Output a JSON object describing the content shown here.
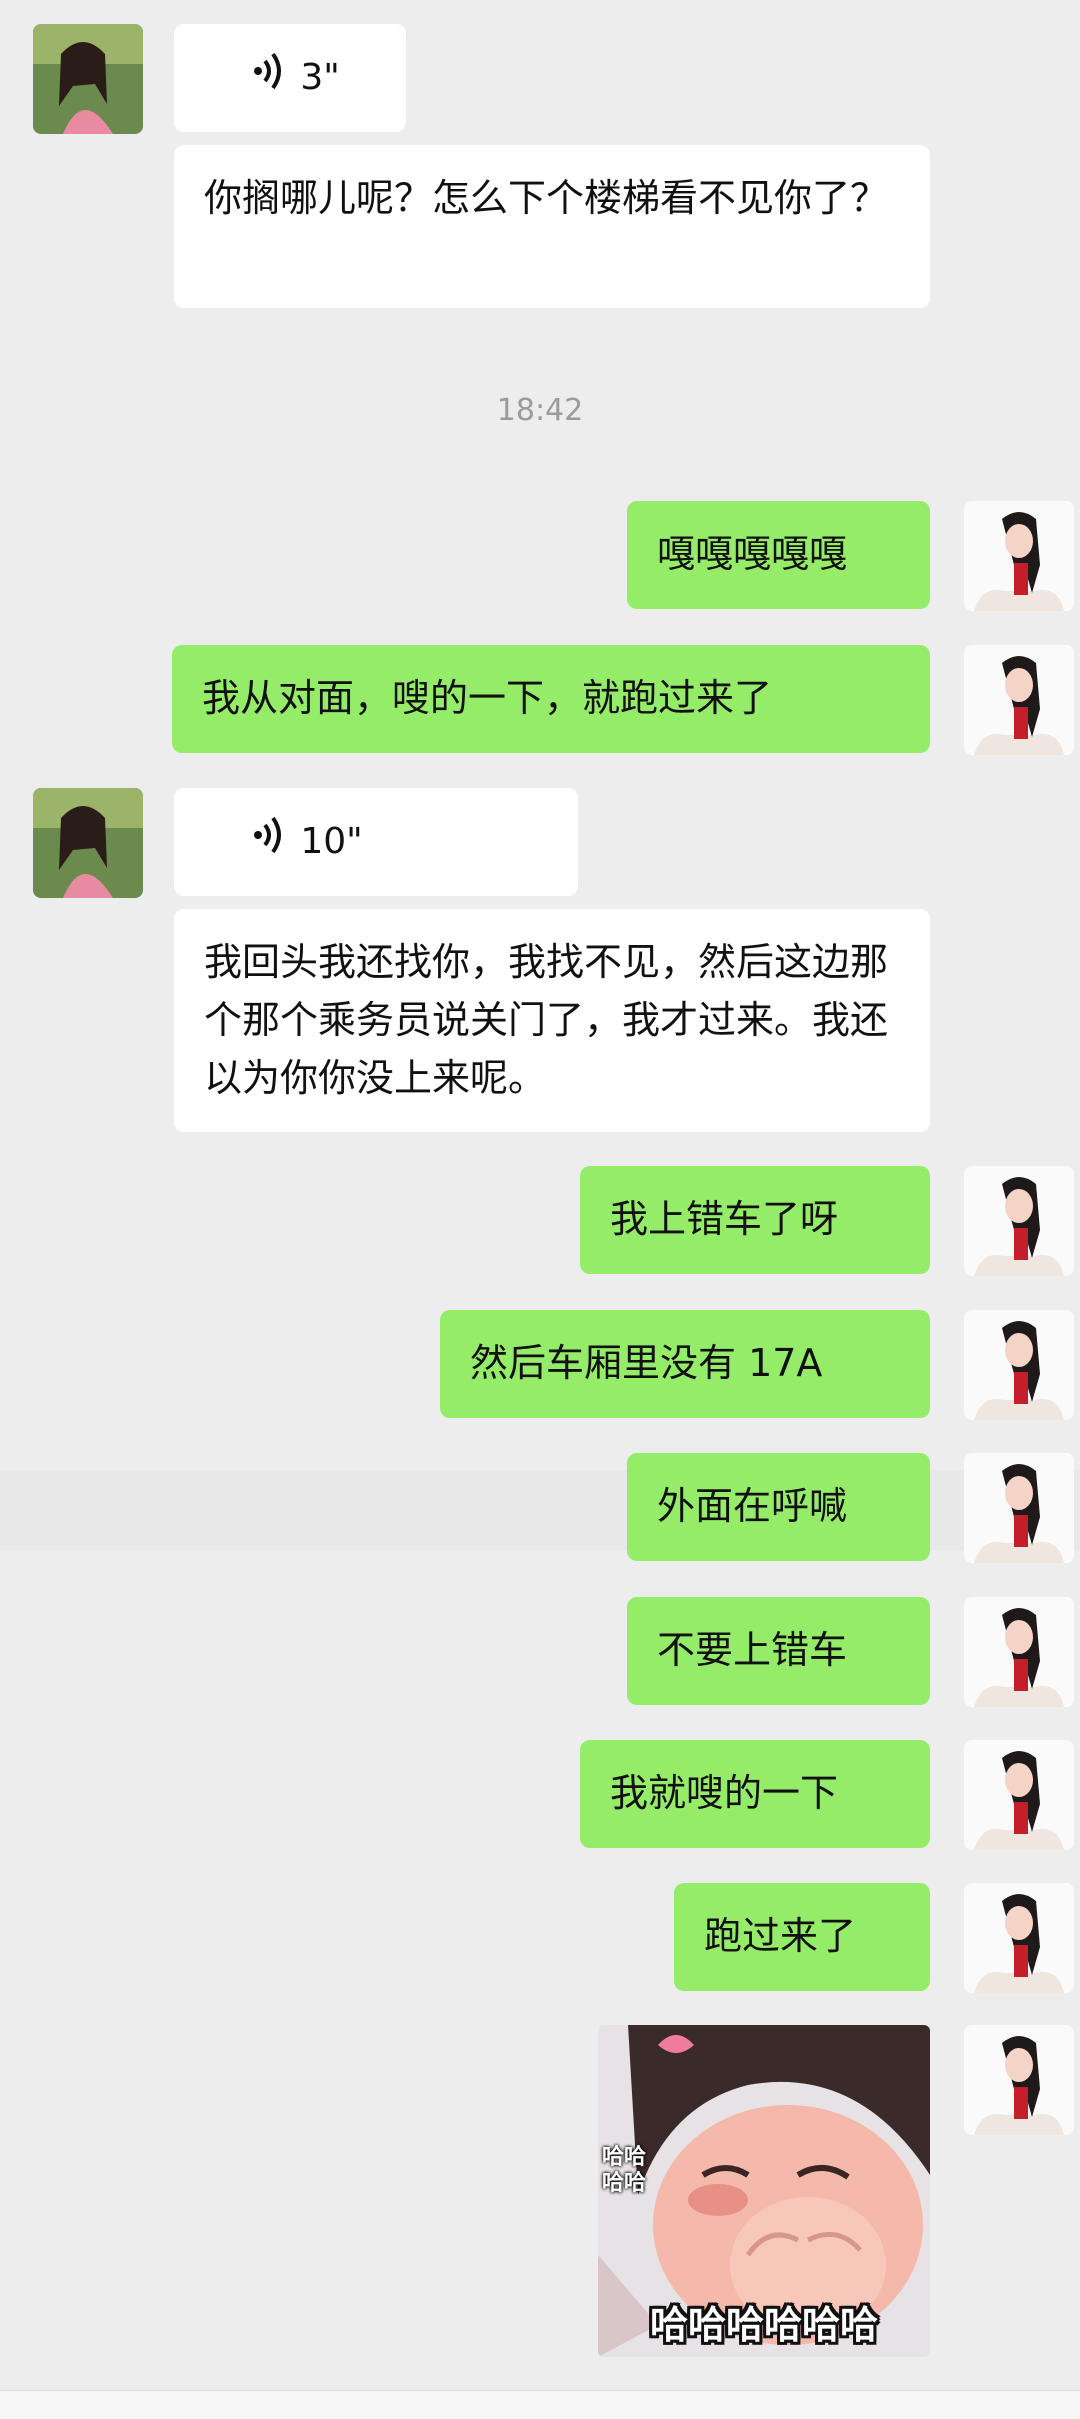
{
  "colors": {
    "background": "#ededed",
    "incoming_bubble": "#ffffff",
    "outgoing_bubble": "#95ec69",
    "timestamp": "#9b9b9b"
  },
  "messages": [
    {
      "side": "left",
      "type": "voice",
      "duration": "3\""
    },
    {
      "side": "left",
      "type": "text",
      "text": "你搁哪儿呢？怎么下个楼梯看不见你了？"
    },
    {
      "type": "timestamp",
      "text": "18:42"
    },
    {
      "side": "right",
      "type": "text",
      "text": "嘎嘎嘎嘎嘎"
    },
    {
      "side": "right",
      "type": "text",
      "text": "我从对面，嗖的一下，就跑过来了"
    },
    {
      "side": "left",
      "type": "voice",
      "duration": "10\""
    },
    {
      "side": "left",
      "type": "text",
      "text": "我回头我还找你，我找不见，然后这边那个那个乘务员说关门了，我才过来。我还以为你你没上来呢。"
    },
    {
      "side": "right",
      "type": "text",
      "text": "我上错车了呀"
    },
    {
      "side": "right",
      "type": "text",
      "text": "然后车厢里没有 17A"
    },
    {
      "side": "right",
      "type": "text",
      "text": "外面在呼喊"
    },
    {
      "side": "right",
      "type": "text",
      "text": "不要上错车"
    },
    {
      "side": "right",
      "type": "text",
      "text": "我就嗖的一下"
    },
    {
      "side": "right",
      "type": "text",
      "text": "跑过来了"
    },
    {
      "side": "right",
      "type": "sticker",
      "caption": "哈哈哈哈哈哈",
      "side_text": "哈哈哈哈"
    }
  ]
}
